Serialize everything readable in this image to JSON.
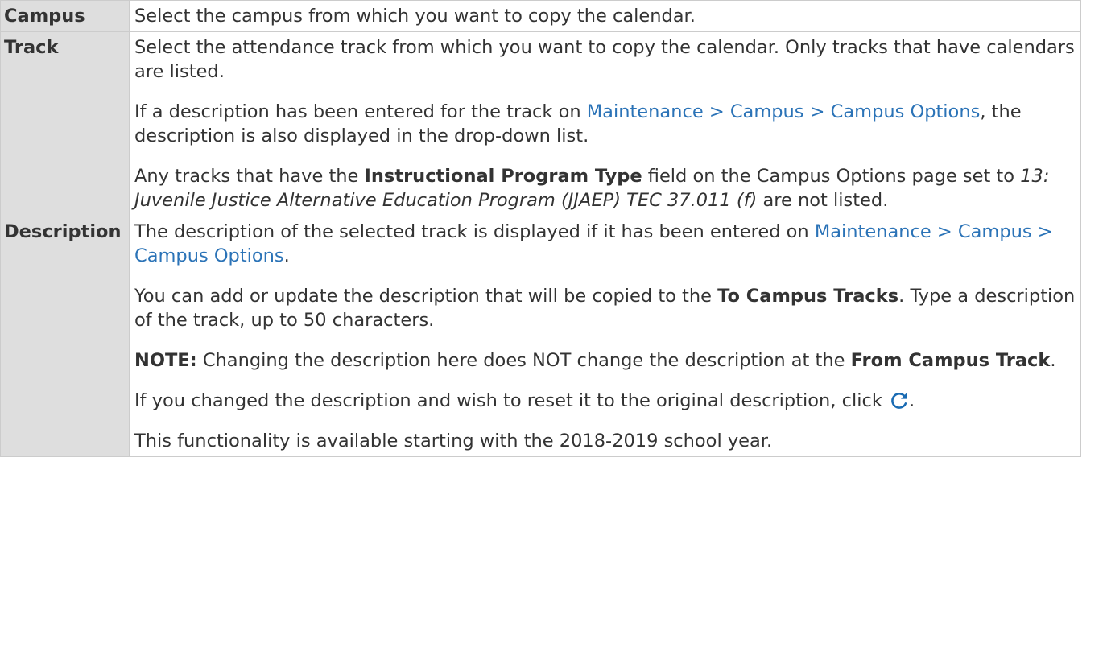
{
  "rows": {
    "campus": {
      "field": "Campus",
      "text": "Select the campus from which you want to copy the calendar."
    },
    "track": {
      "field": "Track",
      "p1": "Select the attendance track from which you want to copy the calendar. Only tracks that have calendars are listed.",
      "p2_before": "If a description has been entered for the track on ",
      "p2_link": "Maintenance > Campus > Campus Options",
      "p2_after": ", the description is also displayed in the drop-down list.",
      "p3_before": "Any tracks that have the ",
      "p3_bold": "Instructional Program Type",
      "p3_mid": " field on the Campus Options page set to ",
      "p3_italic": "13: Juvenile Justice Alternative Education Program (JJAEP) TEC 37.011 (f)",
      "p3_after": " are not listed."
    },
    "description": {
      "field": "Description",
      "p1_before": "The description of the selected track is displayed if it has been entered on ",
      "p1_link": "Maintenance > Campus > Campus Options",
      "p1_after": ".",
      "p2_before": "You can add or update the description that will be copied to the ",
      "p2_bold": "To Campus Tracks",
      "p2_after": ". Type a description of the track, up to 50 characters.",
      "p3_bold": "NOTE:",
      "p3_mid": " Changing the description here does NOT change the description at the ",
      "p3_bold2": "From Campus Track",
      "p3_after": ".",
      "p4_before": "If you changed the description and wish to reset it to the original description, click ",
      "p4_icon": "reset-icon",
      "p4_after": ".",
      "p5": "This functionality is available starting with the 2018-2019 school year."
    }
  },
  "colors": {
    "field_bg": "#dedede",
    "border": "#cccccc",
    "link": "#2b73b7",
    "text": "#333333"
  }
}
